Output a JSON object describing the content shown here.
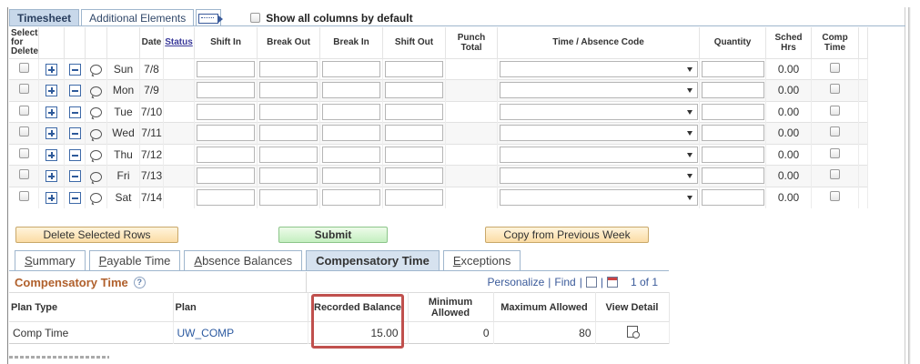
{
  "top_tabs": [
    "Timesheet",
    "Additional Elements"
  ],
  "show_all_label": "Show all columns by default",
  "grid": {
    "headers": {
      "select": "Select for Delete",
      "date": "Date",
      "status": "Status",
      "shift_in": "Shift In",
      "break_out": "Break Out",
      "break_in": "Break In",
      "shift_out": "Shift Out",
      "punch_total": "Punch Total",
      "code": "Time / Absence Code",
      "quantity": "Quantity",
      "sched_hrs": "Sched Hrs",
      "comp_time": "Comp Time"
    },
    "rows": [
      {
        "day": "Sun",
        "date": "7/8",
        "sched": "0.00"
      },
      {
        "day": "Mon",
        "date": "7/9",
        "sched": "0.00"
      },
      {
        "day": "Tue",
        "date": "7/10",
        "sched": "0.00"
      },
      {
        "day": "Wed",
        "date": "7/11",
        "sched": "0.00"
      },
      {
        "day": "Thu",
        "date": "7/12",
        "sched": "0.00"
      },
      {
        "day": "Fri",
        "date": "7/13",
        "sched": "0.00"
      },
      {
        "day": "Sat",
        "date": "7/14",
        "sched": "0.00"
      }
    ]
  },
  "buttons": {
    "delete": "Delete Selected Rows",
    "submit": "Submit",
    "copy": "Copy from Previous Week"
  },
  "bottom_tabs": {
    "summary": {
      "u": "S",
      "rest": "ummary"
    },
    "payable": {
      "u": "P",
      "rest": "ayable Time"
    },
    "absence": {
      "u": "A",
      "rest": "bsence Balances"
    },
    "comp": "Compensatory Time",
    "exceptions": {
      "u": "E",
      "rest": "xceptions"
    }
  },
  "comp_grid": {
    "title": "Compensatory Time",
    "help": "?",
    "personalize": "Personalize",
    "find": "Find",
    "sep": "|",
    "pager": "1 of 1",
    "headers": {
      "plan_type": "Plan Type",
      "plan": "Plan",
      "recorded": "Recorded Balance",
      "min": "Minimum Allowed",
      "max": "Maximum Allowed",
      "detail": "View Detail"
    },
    "row": {
      "plan_type": "Comp Time",
      "plan": "UW_COMP",
      "recorded": "15.00",
      "min": "0",
      "max": "80"
    }
  }
}
